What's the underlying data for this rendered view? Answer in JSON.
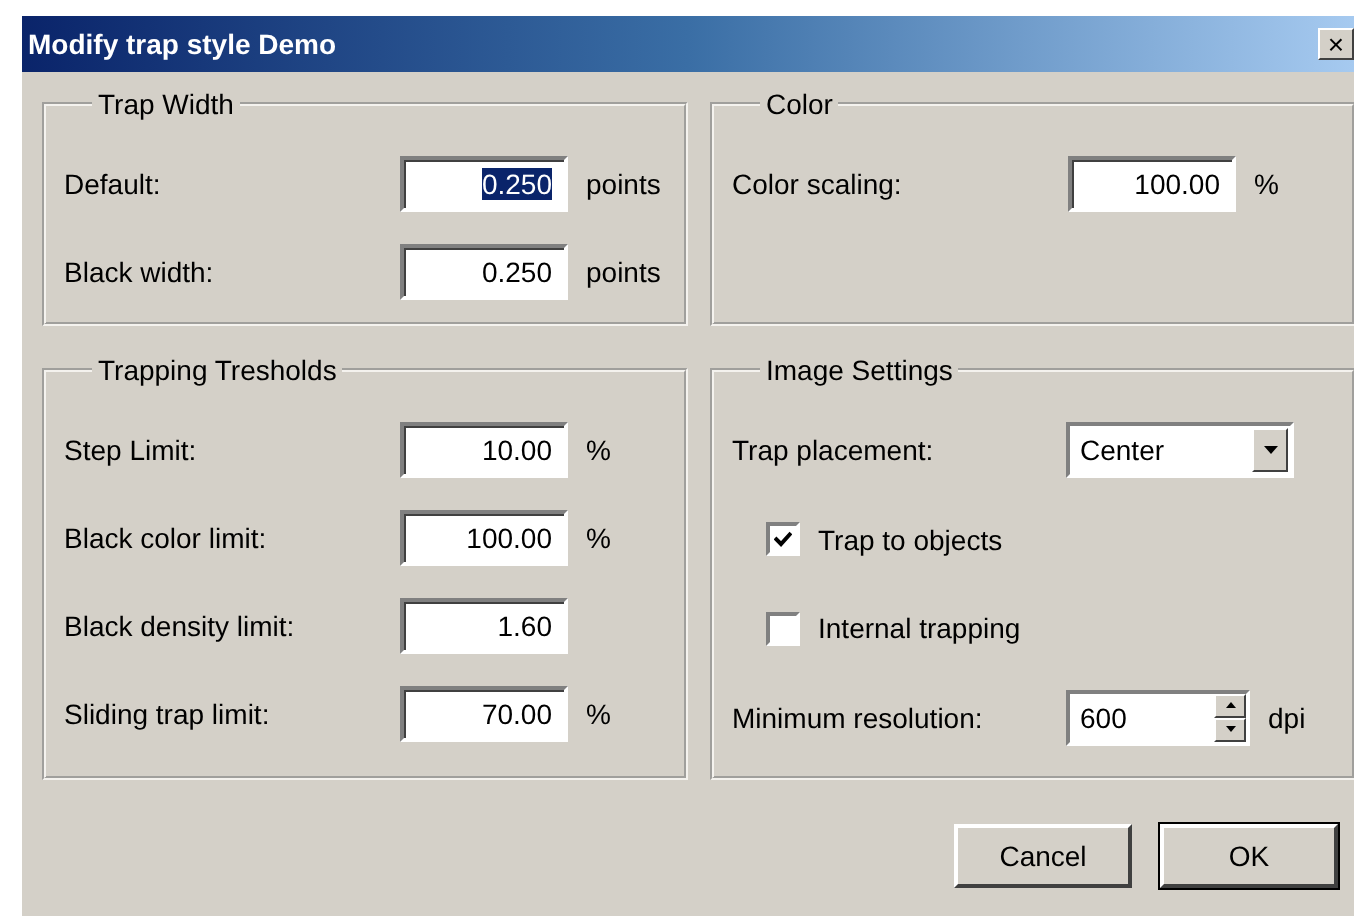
{
  "window": {
    "title": "Modify trap style Demo",
    "close": "×"
  },
  "groups": [
    {
      "title": "Trap Width",
      "rows": [
        {
          "kind": "text",
          "label": "Default:",
          "value": "0.250",
          "unit": "points",
          "text_selected": true
        },
        {
          "kind": "text",
          "label": "Black width:",
          "value": "0.250",
          "unit": "points",
          "text_selected": false
        }
      ]
    },
    {
      "title": "Color",
      "rows": [
        {
          "kind": "text",
          "label": "Color scaling:",
          "value": "100.00",
          "unit": "%",
          "text_selected": false
        }
      ]
    },
    {
      "title": "Trapping Tresholds",
      "rows": [
        {
          "kind": "text",
          "label": "Step Limit:",
          "value": "10.00",
          "unit": "%",
          "text_selected": false
        },
        {
          "kind": "text",
          "label": "Black color limit:",
          "value": "100.00",
          "unit": "%",
          "text_selected": false
        },
        {
          "kind": "text",
          "label": "Black density limit:",
          "value": "1.60",
          "text_selected": false
        },
        {
          "kind": "text",
          "label": "Sliding trap limit:",
          "value": "70.00",
          "unit": "%",
          "text_selected": false
        }
      ]
    },
    {
      "title": "Image Settings",
      "rows": [
        {
          "kind": "dropdown",
          "label": "Trap placement:",
          "value": "Center"
        },
        {
          "kind": "checkbox",
          "label": "Trap to objects",
          "checked": true
        },
        {
          "kind": "checkbox",
          "label": "Internal trapping",
          "checked": false
        },
        {
          "kind": "spinner",
          "label": "Minimum resolution:",
          "value": "600",
          "unit": "dpi"
        }
      ]
    }
  ],
  "buttons": [
    {
      "label": "Cancel",
      "default": false
    },
    {
      "label": "OK",
      "default": true
    }
  ]
}
